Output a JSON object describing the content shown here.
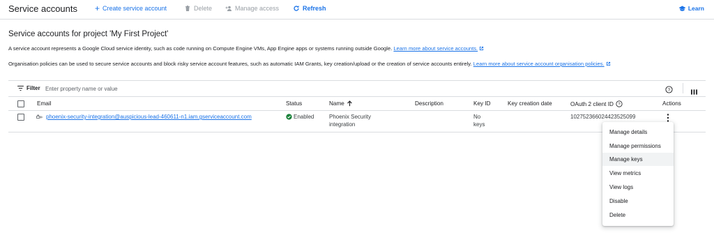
{
  "toolbar": {
    "title": "Service accounts",
    "create_label": "Create service account",
    "delete_label": "Delete",
    "manage_access_label": "Manage access",
    "refresh_label": "Refresh",
    "learn_label": "Learn"
  },
  "header": {
    "title": "Service accounts for project 'My First Project'",
    "desc1_text": "A service account represents a Google Cloud service identity, such as code running on Compute Engine VMs, App Engine apps or systems running outside Google.",
    "desc1_link": "Learn more about service accounts.",
    "desc2_text": "Organisation policies can be used to secure service accounts and block risky service account features, such as automatic IAM Grants, key creation/upload or the creation of service accounts entirely.",
    "desc2_link": "Learn more about service account organisation policies."
  },
  "filter": {
    "label": "Filter",
    "placeholder": "Enter property name or value"
  },
  "table": {
    "columns": {
      "email": "Email",
      "status": "Status",
      "name": "Name",
      "description": "Description",
      "key_id": "Key ID",
      "key_creation_date": "Key creation date",
      "oauth_client_id": "OAuth 2 client ID",
      "actions": "Actions"
    },
    "rows": [
      {
        "email": "phoenix-security-integration@auspicious-lead-460611-n1.iam.gserviceaccount.com",
        "status": "Enabled",
        "name_line1": "Phoenix Security",
        "name_line2": "integration",
        "description": "",
        "key_id_line1": "No",
        "key_id_line2": "keys",
        "key_creation_date": "",
        "oauth_client_id": "102752366024423525099"
      }
    ]
  },
  "actions_menu": {
    "items": [
      "Manage details",
      "Manage permissions",
      "Manage keys",
      "View metrics",
      "View logs",
      "Disable",
      "Delete"
    ],
    "hovered": "Manage keys"
  },
  "colors": {
    "accent": "#1a73e8",
    "enabled_green": "#188038",
    "disabled_gray": "#9aa0a6"
  }
}
